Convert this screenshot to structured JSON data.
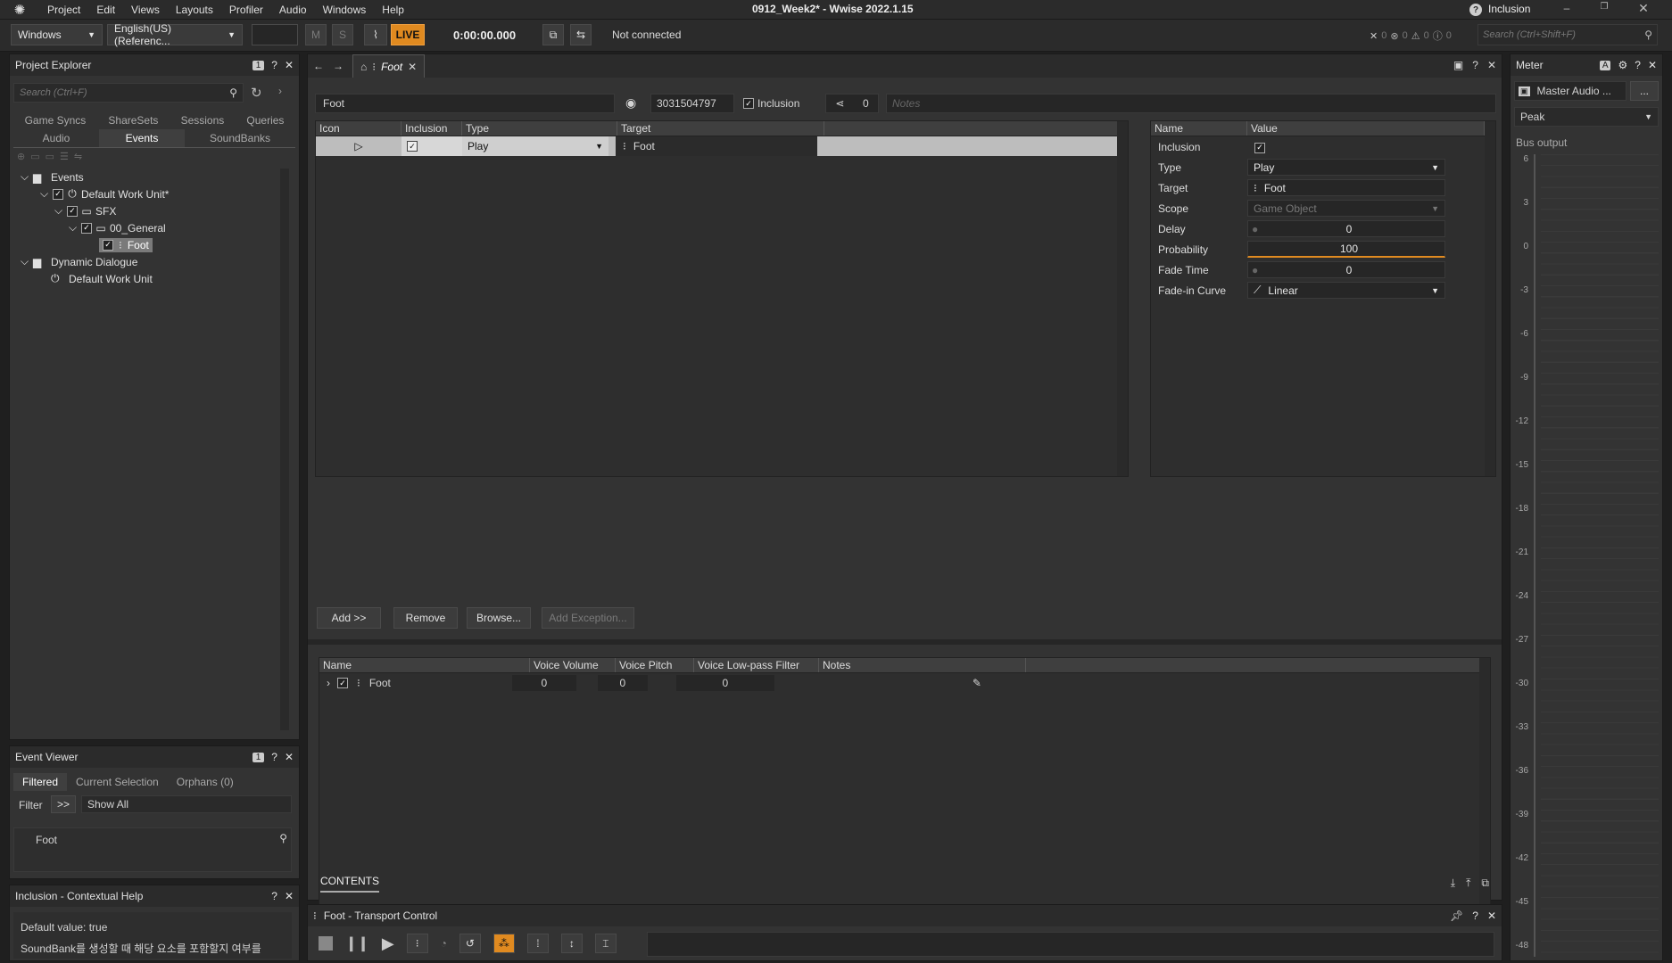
{
  "menu": {
    "items": [
      "Project",
      "Edit",
      "Views",
      "Layouts",
      "Profiler",
      "Audio",
      "Windows",
      "Help"
    ],
    "title": "0912_Week2* - Wwise 2022.1.15",
    "context": "Inclusion"
  },
  "toolbar": {
    "platform": "Windows",
    "language": "English(US) (Referenc...",
    "mute": "M",
    "solo": "S",
    "live": "LIVE",
    "time": "0:00:00.000",
    "connection": "Not connected",
    "counts": [
      "0",
      "0",
      "0",
      "0"
    ],
    "search_placeholder": "Search (Ctrl+Shift+F)"
  },
  "project_explorer": {
    "title": "Project Explorer",
    "badge": "1",
    "search_placeholder": "Search (Ctrl+F)",
    "tabs_row1": [
      "Game Syncs",
      "ShareSets",
      "Sessions",
      "Queries"
    ],
    "tabs_row2": [
      "Audio",
      "Events",
      "SoundBanks"
    ],
    "tree": [
      {
        "label": "Events"
      },
      {
        "label": "Default Work Unit*"
      },
      {
        "label": "SFX"
      },
      {
        "label": "00_General"
      },
      {
        "label": "Foot"
      },
      {
        "label": "Dynamic Dialogue"
      },
      {
        "label": "Default Work Unit"
      }
    ]
  },
  "event_viewer": {
    "title": "Event Viewer",
    "badge": "1",
    "tabs": [
      "Filtered",
      "Current Selection",
      "Orphans (0)"
    ],
    "filter_label": "Filter",
    "filter_btn": ">>",
    "filter_value": "Show All",
    "item": "Foot"
  },
  "help": {
    "title": "Inclusion - Contextual Help",
    "line1": "Default value: true",
    "line2": "SoundBank를 생성할 때 해당 요소를 포함할지 여부를"
  },
  "editor": {
    "tab_label": "Foot",
    "name": "Foot",
    "id": "3031504797",
    "inclusion_label": "Inclusion",
    "refs": "0",
    "notes_placeholder": "Notes",
    "actions_headers": [
      "Icon",
      "Inclusion",
      "Type",
      "Target"
    ],
    "action_row": {
      "type": "Play",
      "target": "Foot"
    },
    "buttons": [
      "Add >>",
      "Remove",
      "Browse...",
      "Add Exception..."
    ],
    "props_headers": [
      "Name",
      "Value"
    ],
    "props": [
      {
        "name": "Inclusion",
        "value": ""
      },
      {
        "name": "Type",
        "value": "Play"
      },
      {
        "name": "Target",
        "value": "Foot"
      },
      {
        "name": "Scope",
        "value": "Game Object"
      },
      {
        "name": "Delay",
        "value": "0"
      },
      {
        "name": "Probability",
        "value": "100"
      },
      {
        "name": "Fade Time",
        "value": "0"
      },
      {
        "name": "Fade-in Curve",
        "value": "Linear"
      }
    ],
    "contents_headers": [
      "Name",
      "Voice Volume",
      "Voice Pitch",
      "Voice Low-pass Filter",
      "Notes"
    ],
    "contents_row": {
      "name": "Foot",
      "volume": "0",
      "pitch": "0",
      "lpf": "0"
    },
    "contents_tab": "CONTENTS"
  },
  "transport": {
    "title": "Foot - Transport Control"
  },
  "meter": {
    "title": "Meter",
    "bus": "Master Audio ...",
    "more": "...",
    "mode": "Peak",
    "label": "Bus output",
    "ticks": [
      "6",
      "3",
      "0",
      "-3",
      "-6",
      "-9",
      "-12",
      "-15",
      "-18",
      "-21",
      "-24",
      "-27",
      "-30",
      "-33",
      "-36",
      "-39",
      "-42",
      "-45",
      "-48"
    ]
  }
}
